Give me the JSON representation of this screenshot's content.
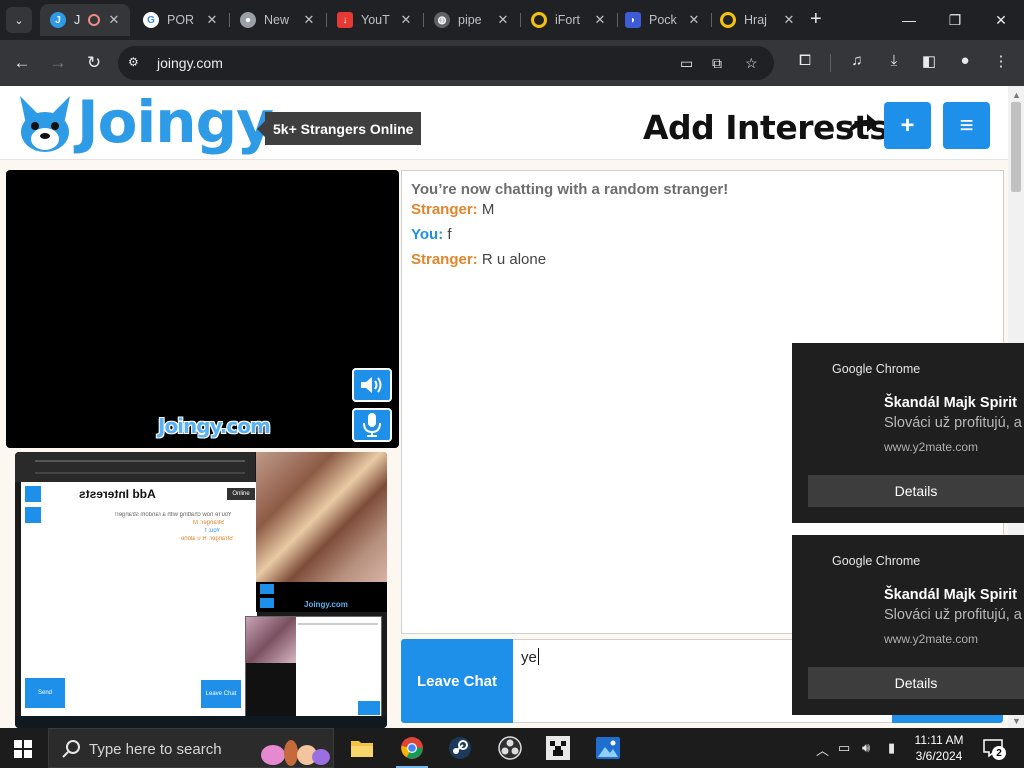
{
  "browser": {
    "tabs": [
      {
        "title": "J",
        "favicon": "joingy-icon",
        "color": "#2e9be6",
        "active": true
      },
      {
        "title": "POR",
        "favicon": "google-icon",
        "color": "#ffffff"
      },
      {
        "title": "New",
        "favicon": "chrome-icon",
        "color": "#9aa0a6"
      },
      {
        "title": "YouT",
        "favicon": "download-icon",
        "color": "#e53935"
      },
      {
        "title": "pipe",
        "favicon": "globe-icon",
        "color": "#9aa0a6"
      },
      {
        "title": "iFort",
        "favicon": "circle-icon",
        "color": "#f4c20d"
      },
      {
        "title": "Pock",
        "favicon": "pocket-icon",
        "color": "#3e5bd8"
      },
      {
        "title": "Hraj",
        "favicon": "circle-icon",
        "color": "#f4c20d"
      }
    ],
    "url": "joingy.com"
  },
  "site": {
    "logo_text": "Joingy",
    "online_badge": "5k+ Strangers Online",
    "add_interests": "Add Interests",
    "plus_label": "+",
    "menu_label": "≡",
    "video_watermark": "Joingy.com",
    "leave_button": "Leave Chat",
    "message_value": "ye"
  },
  "chat": {
    "system_message": "You’re now chatting with a random stranger!",
    "messages": [
      {
        "sender": "Stranger:",
        "text": " M"
      },
      {
        "sender": "You:",
        "text": " f"
      },
      {
        "sender": "Stranger:",
        "text": " R u alone"
      }
    ]
  },
  "self_view": {
    "add_interests": "Add Interests",
    "online": "Online",
    "sys_message": "You're now chatting with a random stranger!",
    "lines": [
      "Stranger: M",
      "You: f",
      "Stranger: R u alone"
    ],
    "send": "Send",
    "leave": "Leave Chat",
    "watermark": "Joingy.com"
  },
  "notifications": [
    {
      "app": "Google Chrome",
      "title": "Škandál Majk Spirit",
      "body": "Slováci už profitujú, a",
      "source": "www.y2mate.com",
      "action": "Details"
    },
    {
      "app": "Google Chrome",
      "title": "Škandál Majk Spirit",
      "body": "Slováci už profitujú, a",
      "source": "www.y2mate.com",
      "action": "Details"
    }
  ],
  "taskbar": {
    "search_placeholder": "Type here to search",
    "time": "11:11 AM",
    "date": "3/6/2024",
    "notification_count": "2"
  },
  "colors": {
    "accent": "#1e90ea",
    "stranger": "#e3852a",
    "logo": "#2e9be6"
  }
}
